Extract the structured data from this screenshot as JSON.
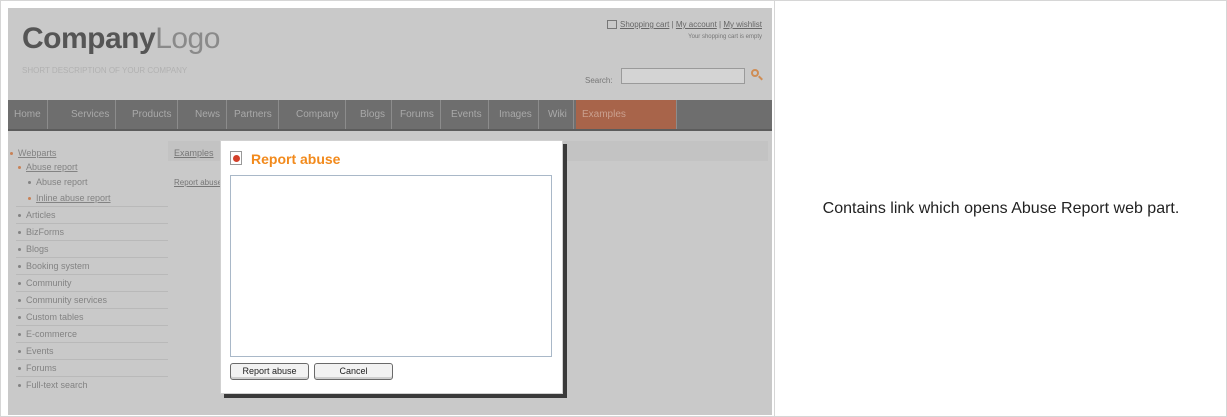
{
  "site": {
    "logo_part1": "Company",
    "logo_part2": "Logo",
    "tagline": "SHORT DESCRIPTION OF YOUR COMPANY",
    "top_links": [
      "Shopping cart",
      "My account",
      "My wishlist"
    ],
    "cart_status": "Your shopping cart is empty",
    "search_label": "Search:",
    "search_value": ""
  },
  "nav": {
    "items": [
      "Home",
      "Services",
      "Products",
      "News",
      "Partners",
      "Company",
      "Blogs",
      "Forums",
      "Events",
      "Images",
      "Wiki",
      "Examples"
    ],
    "active": "Examples"
  },
  "sidebar": {
    "items": [
      {
        "label": "Webparts",
        "link": true
      },
      {
        "label": "Abuse report",
        "link": true,
        "selected": true
      },
      {
        "label": "Abuse report",
        "link": false
      },
      {
        "label": "Inline abuse report",
        "link": true,
        "selected": true
      },
      {
        "label": "Articles",
        "link": false
      },
      {
        "label": "BizForms",
        "link": false
      },
      {
        "label": "Blogs",
        "link": false
      },
      {
        "label": "Booking system",
        "link": false
      },
      {
        "label": "Community",
        "link": false
      },
      {
        "label": "Community services",
        "link": false
      },
      {
        "label": "Custom tables",
        "link": false
      },
      {
        "label": "E-commerce",
        "link": false
      },
      {
        "label": "Events",
        "link": false
      },
      {
        "label": "Forums",
        "link": false
      },
      {
        "label": "Full-text search",
        "link": false
      }
    ]
  },
  "main": {
    "breadcrumb": "Examples",
    "report_link": "Report abuse"
  },
  "dialog": {
    "title": "Report abuse",
    "textarea_value": "",
    "report_button": "Report abuse",
    "cancel_button": "Cancel"
  },
  "caption": "Contains link which opens Abuse Report web part.",
  "colors": {
    "accent_orange": "#f28a1c",
    "nav_active": "#a8644a",
    "overlay_gray": "#c9c9c9"
  }
}
